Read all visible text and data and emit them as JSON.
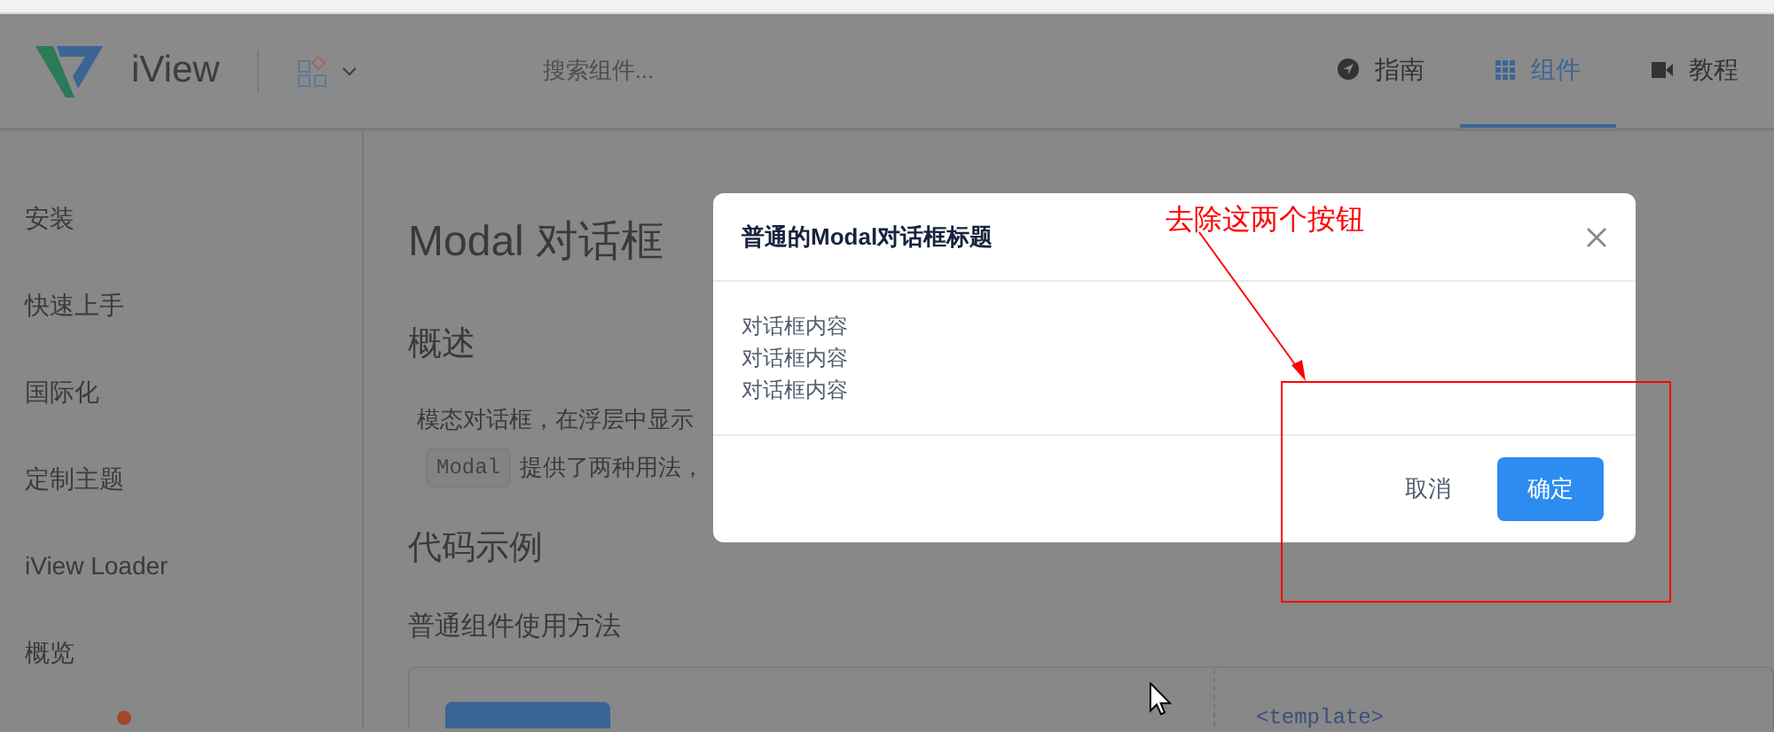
{
  "header": {
    "logo_text": "iView",
    "search": {
      "placeholder": "搜索组件..."
    },
    "nav": [
      {
        "label": "指南",
        "kind": "guide",
        "selected": false
      },
      {
        "label": "组件",
        "kind": "components",
        "selected": true
      },
      {
        "label": "教程",
        "kind": "video",
        "selected": false
      }
    ]
  },
  "sidebar": {
    "items": [
      {
        "label": "安装"
      },
      {
        "label": "快速上手"
      },
      {
        "label": "国际化"
      },
      {
        "label": "定制主题"
      },
      {
        "label": "iView Loader"
      },
      {
        "label": "概览"
      }
    ]
  },
  "content": {
    "title": "Modal 对话框",
    "overview_heading": "概述",
    "paragraph_1": "模态对话框，在浮层中显示",
    "paragraph_2_code": "Modal",
    "paragraph_2": "提供了两种用法，",
    "examples_heading": "代码示例",
    "example_title": "普通组件使用方法",
    "code_line": "<template>"
  },
  "modal": {
    "title": "普通的Modal对话框标题",
    "body": [
      "对话框内容",
      "对话框内容",
      "对话框内容"
    ],
    "buttons": [
      {
        "label": "取消",
        "kind": "text"
      },
      {
        "label": "确定",
        "kind": "primary"
      }
    ]
  },
  "annotation": {
    "text": "去除这两个按钮"
  }
}
